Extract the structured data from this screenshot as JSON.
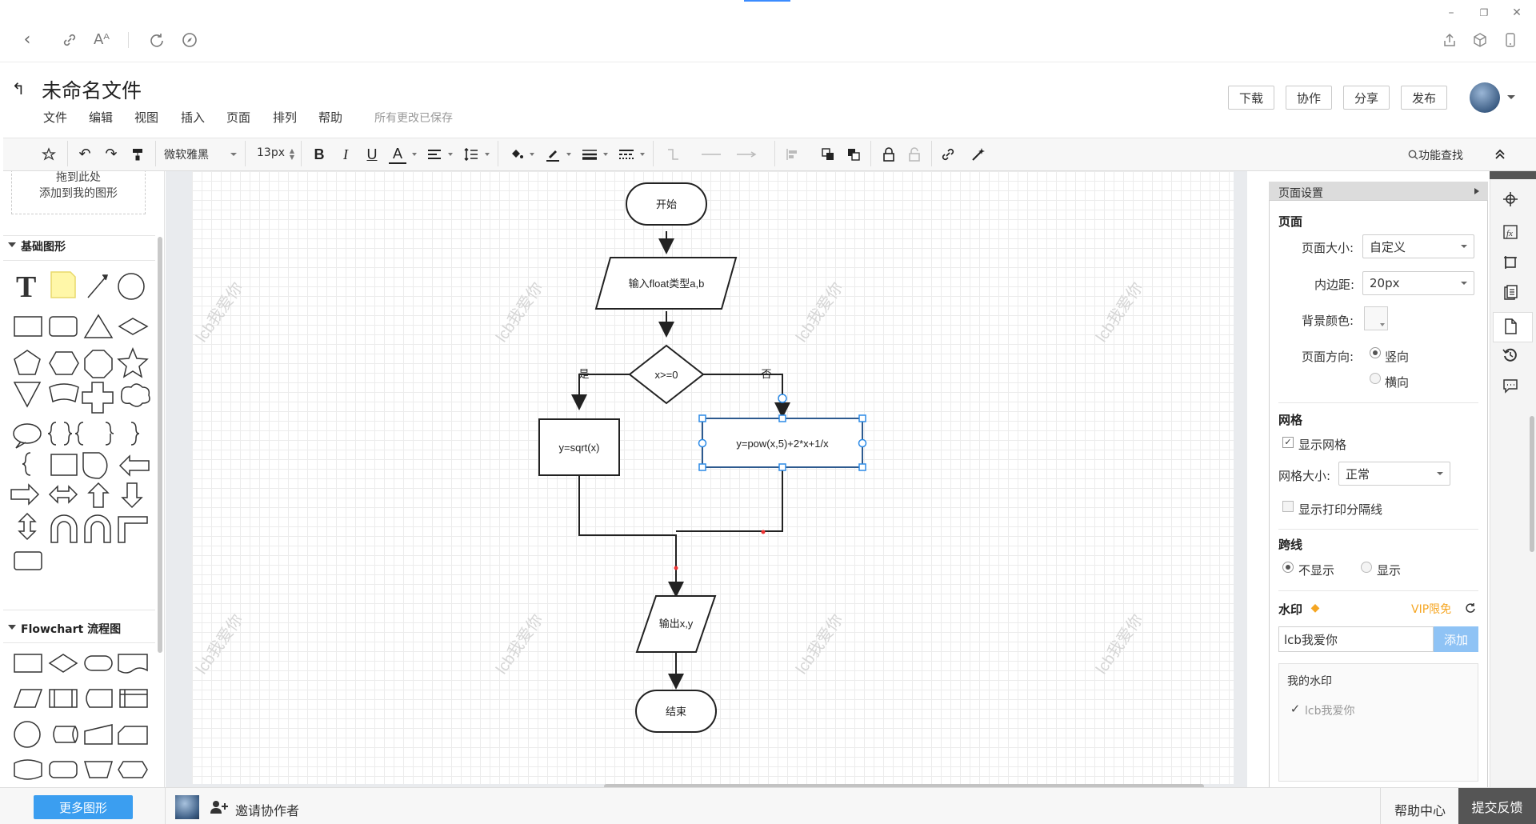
{
  "header": {
    "title": "未命名文件",
    "menu": [
      "文件",
      "编辑",
      "视图",
      "插入",
      "页面",
      "排列",
      "帮助"
    ],
    "save_status": "所有更改已保存",
    "buttons": {
      "download": "下载",
      "collab": "协作",
      "share": "分享",
      "publish": "发布"
    }
  },
  "toolbar": {
    "font": "微软雅黑",
    "font_size": "13px",
    "bold": "B",
    "italic": "I",
    "underline": "U",
    "font_color": "A",
    "search": "功能查找"
  },
  "left_panel": {
    "drop_hint_line1": "拖到此处",
    "drop_hint_line2": "添加到我的图形",
    "section_basic": "基础图形",
    "section_flowchart": "Flowchart 流程图",
    "more_shapes": "更多图形"
  },
  "diagram": {
    "nodes": {
      "start": "开始",
      "input": "输入float类型a,b",
      "cond": "x>=0",
      "yes_box": "y=sqrt(x)",
      "no_box": "y=pow(x,5)+2*x+1/x",
      "output": "输出x,y",
      "end": "结束"
    },
    "labels": {
      "yes": "是",
      "no": "否"
    },
    "watermark": "lcb我爱你"
  },
  "page_settings": {
    "title": "页面设置",
    "section_page": "页面",
    "page_size_label": "页面大小:",
    "page_size_value": "自定义",
    "padding_label": "内边距:",
    "padding_value": "20px",
    "bg_color_label": "背景颜色:",
    "orientation_label": "页面方向:",
    "orientation_portrait": "竖向",
    "orientation_landscape": "横向",
    "section_grid": "网格",
    "show_grid": "显示网格",
    "grid_size_label": "网格大小:",
    "grid_size_value": "正常",
    "show_print_lines": "显示打印分隔线",
    "section_cross": "跨线",
    "cross_hide": "不显示",
    "cross_show": "显示",
    "section_watermark": "水印",
    "vip": "VIP限免",
    "watermark_input": "lcb我爱你",
    "add_button": "添加",
    "my_watermarks": "我的水印",
    "saved_watermark": "lcb我爱你"
  },
  "statusbar": {
    "invite": "邀请协作者",
    "help": "帮助中心",
    "feedback": "提交反馈"
  }
}
